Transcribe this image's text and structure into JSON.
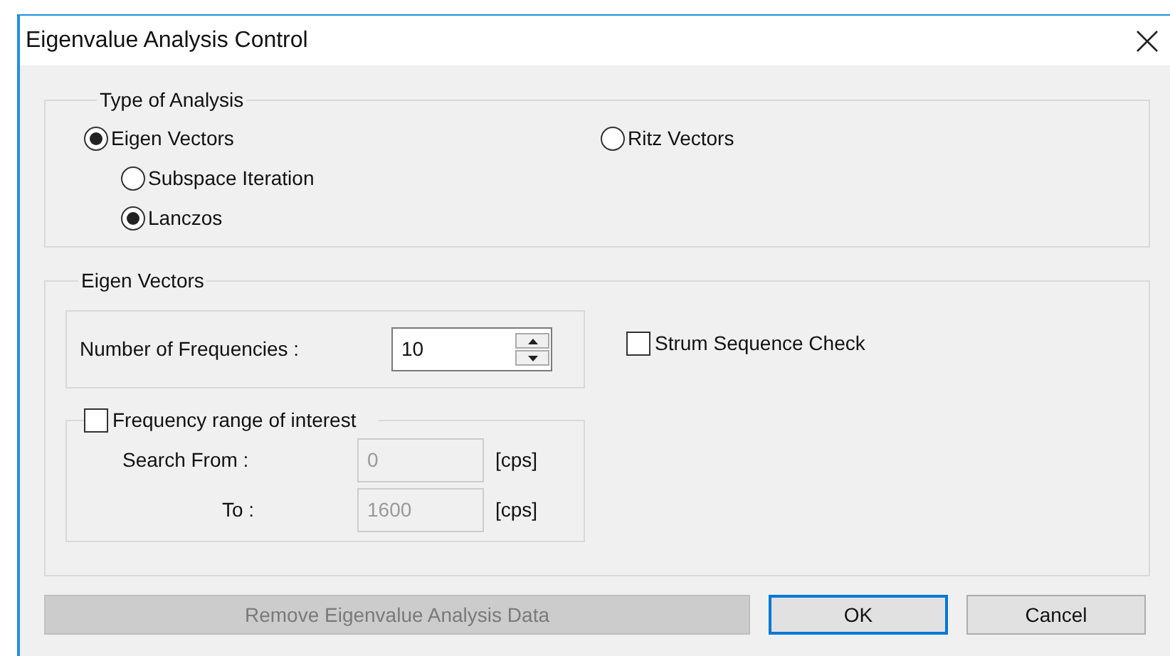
{
  "window": {
    "title": "Eigenvalue Analysis Control"
  },
  "type_of_analysis": {
    "legend": "Type of Analysis",
    "options": [
      {
        "label": "Eigen Vectors",
        "selected": true,
        "children": [
          {
            "label": "Subspace Iteration",
            "selected": false
          },
          {
            "label": "Lanczos",
            "selected": true
          }
        ]
      },
      {
        "label": "Ritz Vectors",
        "selected": false
      }
    ]
  },
  "eigen_vectors": {
    "legend": "Eigen Vectors",
    "number_of_frequencies": {
      "label": "Number of Frequencies :",
      "value": "10"
    },
    "strum_sequence_check": {
      "label": "Strum Sequence Check",
      "checked": false
    },
    "frequency_range": {
      "label": "Frequency range of interest",
      "checked": false,
      "fields": [
        {
          "label": "Search From :",
          "value": "0",
          "unit": "[cps]",
          "disabled": true
        },
        {
          "label": "To :",
          "value": "1600",
          "unit": "[cps]",
          "disabled": true
        }
      ]
    }
  },
  "buttons": [
    {
      "label": "Remove Eigenvalue Analysis Data",
      "disabled": true,
      "default": false
    },
    {
      "label": "OK",
      "disabled": false,
      "default": true
    },
    {
      "label": "Cancel",
      "disabled": false,
      "default": false
    }
  ]
}
